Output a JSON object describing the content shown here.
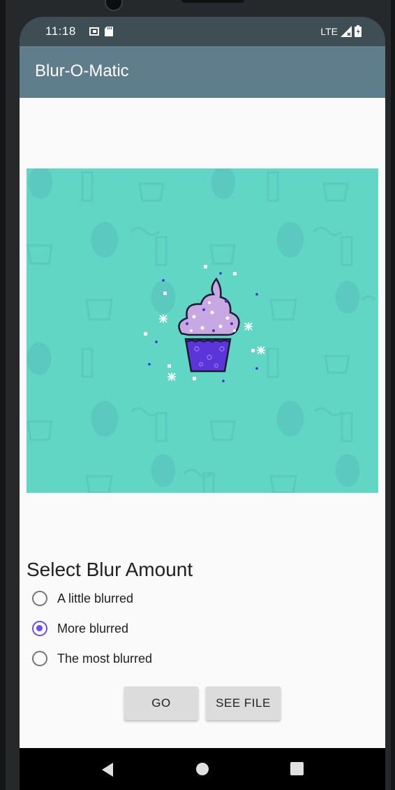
{
  "status_bar": {
    "time": "11:18",
    "network": "LTE",
    "left_icons": [
      "sim-icon",
      "sd-card-icon"
    ],
    "right_icons": [
      "signal-icon",
      "battery-icon"
    ]
  },
  "app_bar": {
    "title": "Blur-O-Matic"
  },
  "image": {
    "subject": "cupcake-icon",
    "background_color": "#62d6c4"
  },
  "blur_selector": {
    "title": "Select Blur Amount",
    "options": [
      {
        "label": "A little blurred",
        "checked": false
      },
      {
        "label": "More blurred",
        "checked": true
      },
      {
        "label": "The most blurred",
        "checked": false
      }
    ]
  },
  "buttons": {
    "go": "GO",
    "see_file": "SEE FILE"
  },
  "nav_bar": {
    "icons": [
      "back-icon",
      "home-icon",
      "recents-icon"
    ]
  },
  "colors": {
    "app_bar": "#607d8b",
    "status_bar": "#3f4d55",
    "accent": "#6a4ff0"
  }
}
